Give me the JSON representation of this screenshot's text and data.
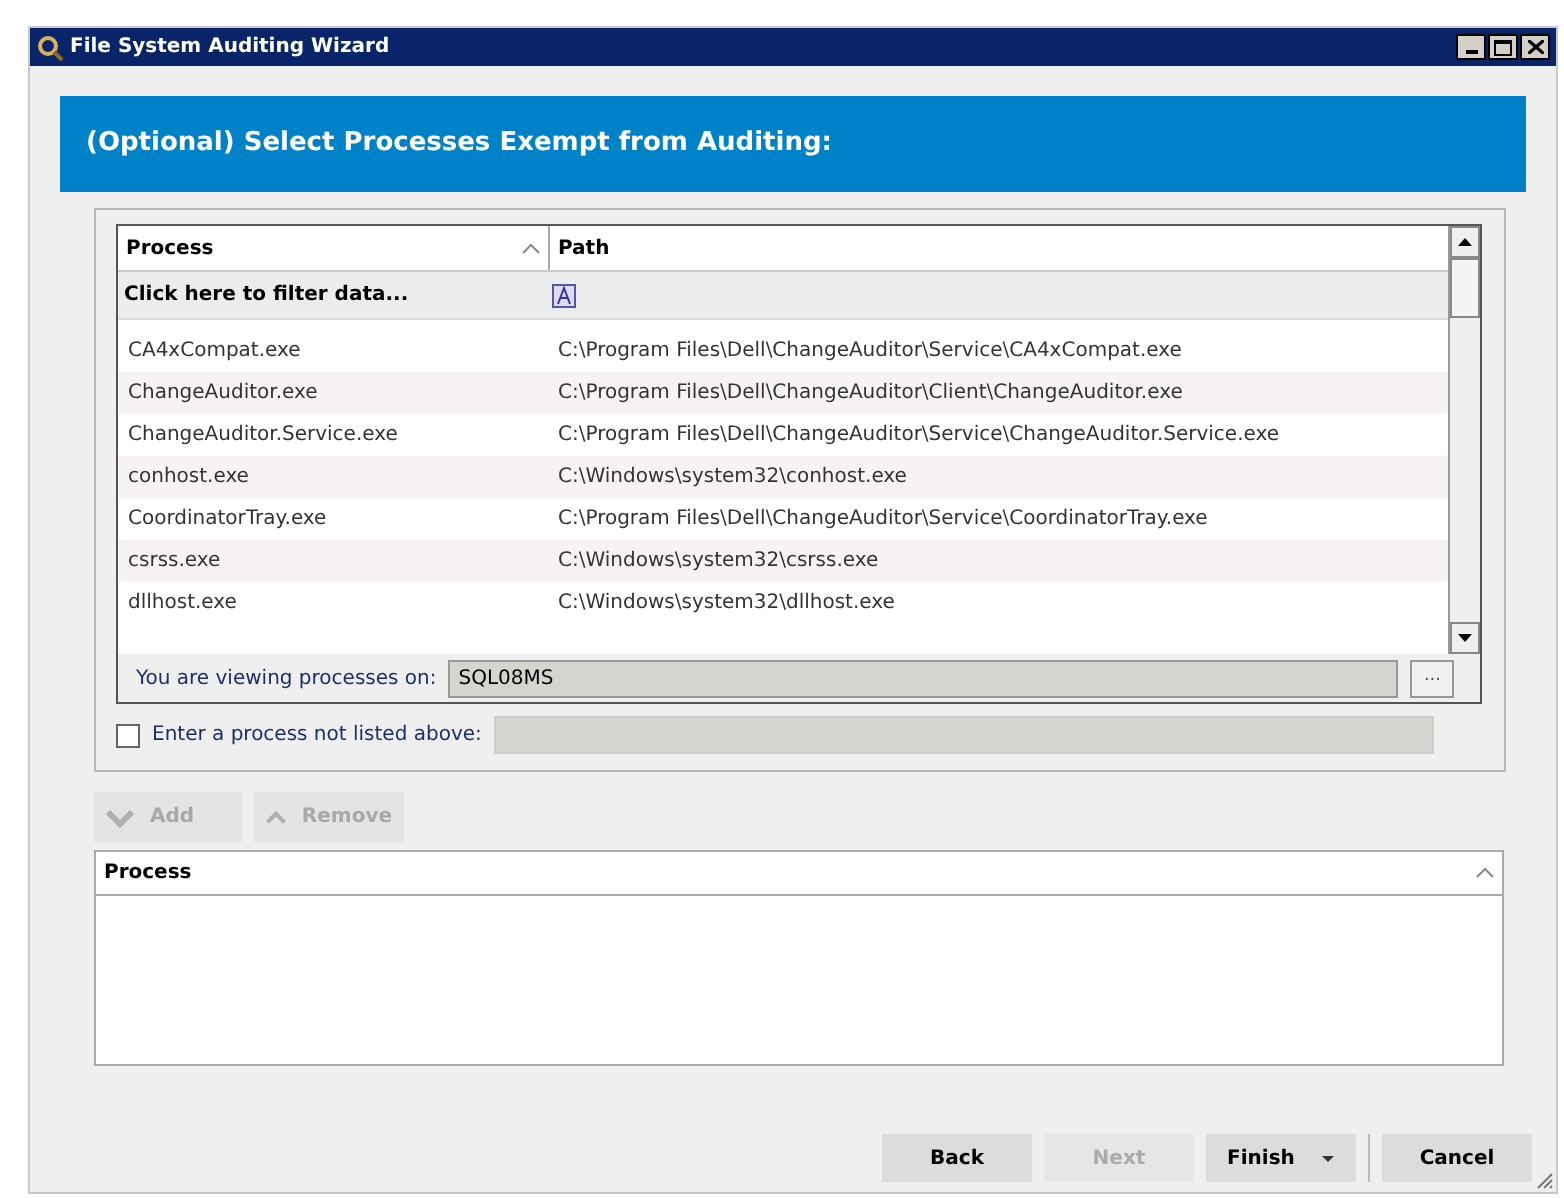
{
  "window": {
    "title": "File System Auditing Wizard"
  },
  "banner": "(Optional) Select Processes Exempt from Auditing:",
  "process_table": {
    "columns": [
      {
        "label": "Process",
        "sorted": true
      },
      {
        "label": "Path",
        "sorted": false
      }
    ],
    "filter_text": "Click here to filter data...",
    "rows": [
      {
        "process": "CA4xCompat.exe",
        "path": "C:\\Program Files\\Dell\\ChangeAuditor\\Service\\CA4xCompat.exe"
      },
      {
        "process": "ChangeAuditor.exe",
        "path": "C:\\Program Files\\Dell\\ChangeAuditor\\Client\\ChangeAuditor.exe"
      },
      {
        "process": "ChangeAuditor.Service.exe",
        "path": "C:\\Program Files\\Dell\\ChangeAuditor\\Service\\ChangeAuditor.Service.exe"
      },
      {
        "process": "conhost.exe",
        "path": "C:\\Windows\\system32\\conhost.exe"
      },
      {
        "process": "CoordinatorTray.exe",
        "path": "C:\\Program Files\\Dell\\ChangeAuditor\\Service\\CoordinatorTray.exe"
      },
      {
        "process": "csrss.exe",
        "path": "C:\\Windows\\system32\\csrss.exe"
      },
      {
        "process": "dllhost.exe",
        "path": "C:\\Windows\\system32\\dllhost.exe"
      }
    ]
  },
  "viewing": {
    "label": "You are viewing processes on:",
    "value": "SQL08MS",
    "browse": "..."
  },
  "manual_entry": {
    "label": "Enter a process not listed above:",
    "checked": false
  },
  "list_buttons": [
    {
      "label": "Add",
      "kind": "down",
      "disabled": true
    },
    {
      "label": "Remove",
      "kind": "up",
      "disabled": true
    }
  ],
  "exempt_list": {
    "column": "Process"
  },
  "footer_buttons": [
    {
      "label": "Back",
      "disabled": false,
      "dropdown": false
    },
    {
      "label": "Next",
      "disabled": true,
      "dropdown": false
    },
    {
      "label": "Finish",
      "disabled": false,
      "dropdown": true
    },
    {
      "label": "Cancel",
      "disabled": false,
      "dropdown": false
    }
  ]
}
